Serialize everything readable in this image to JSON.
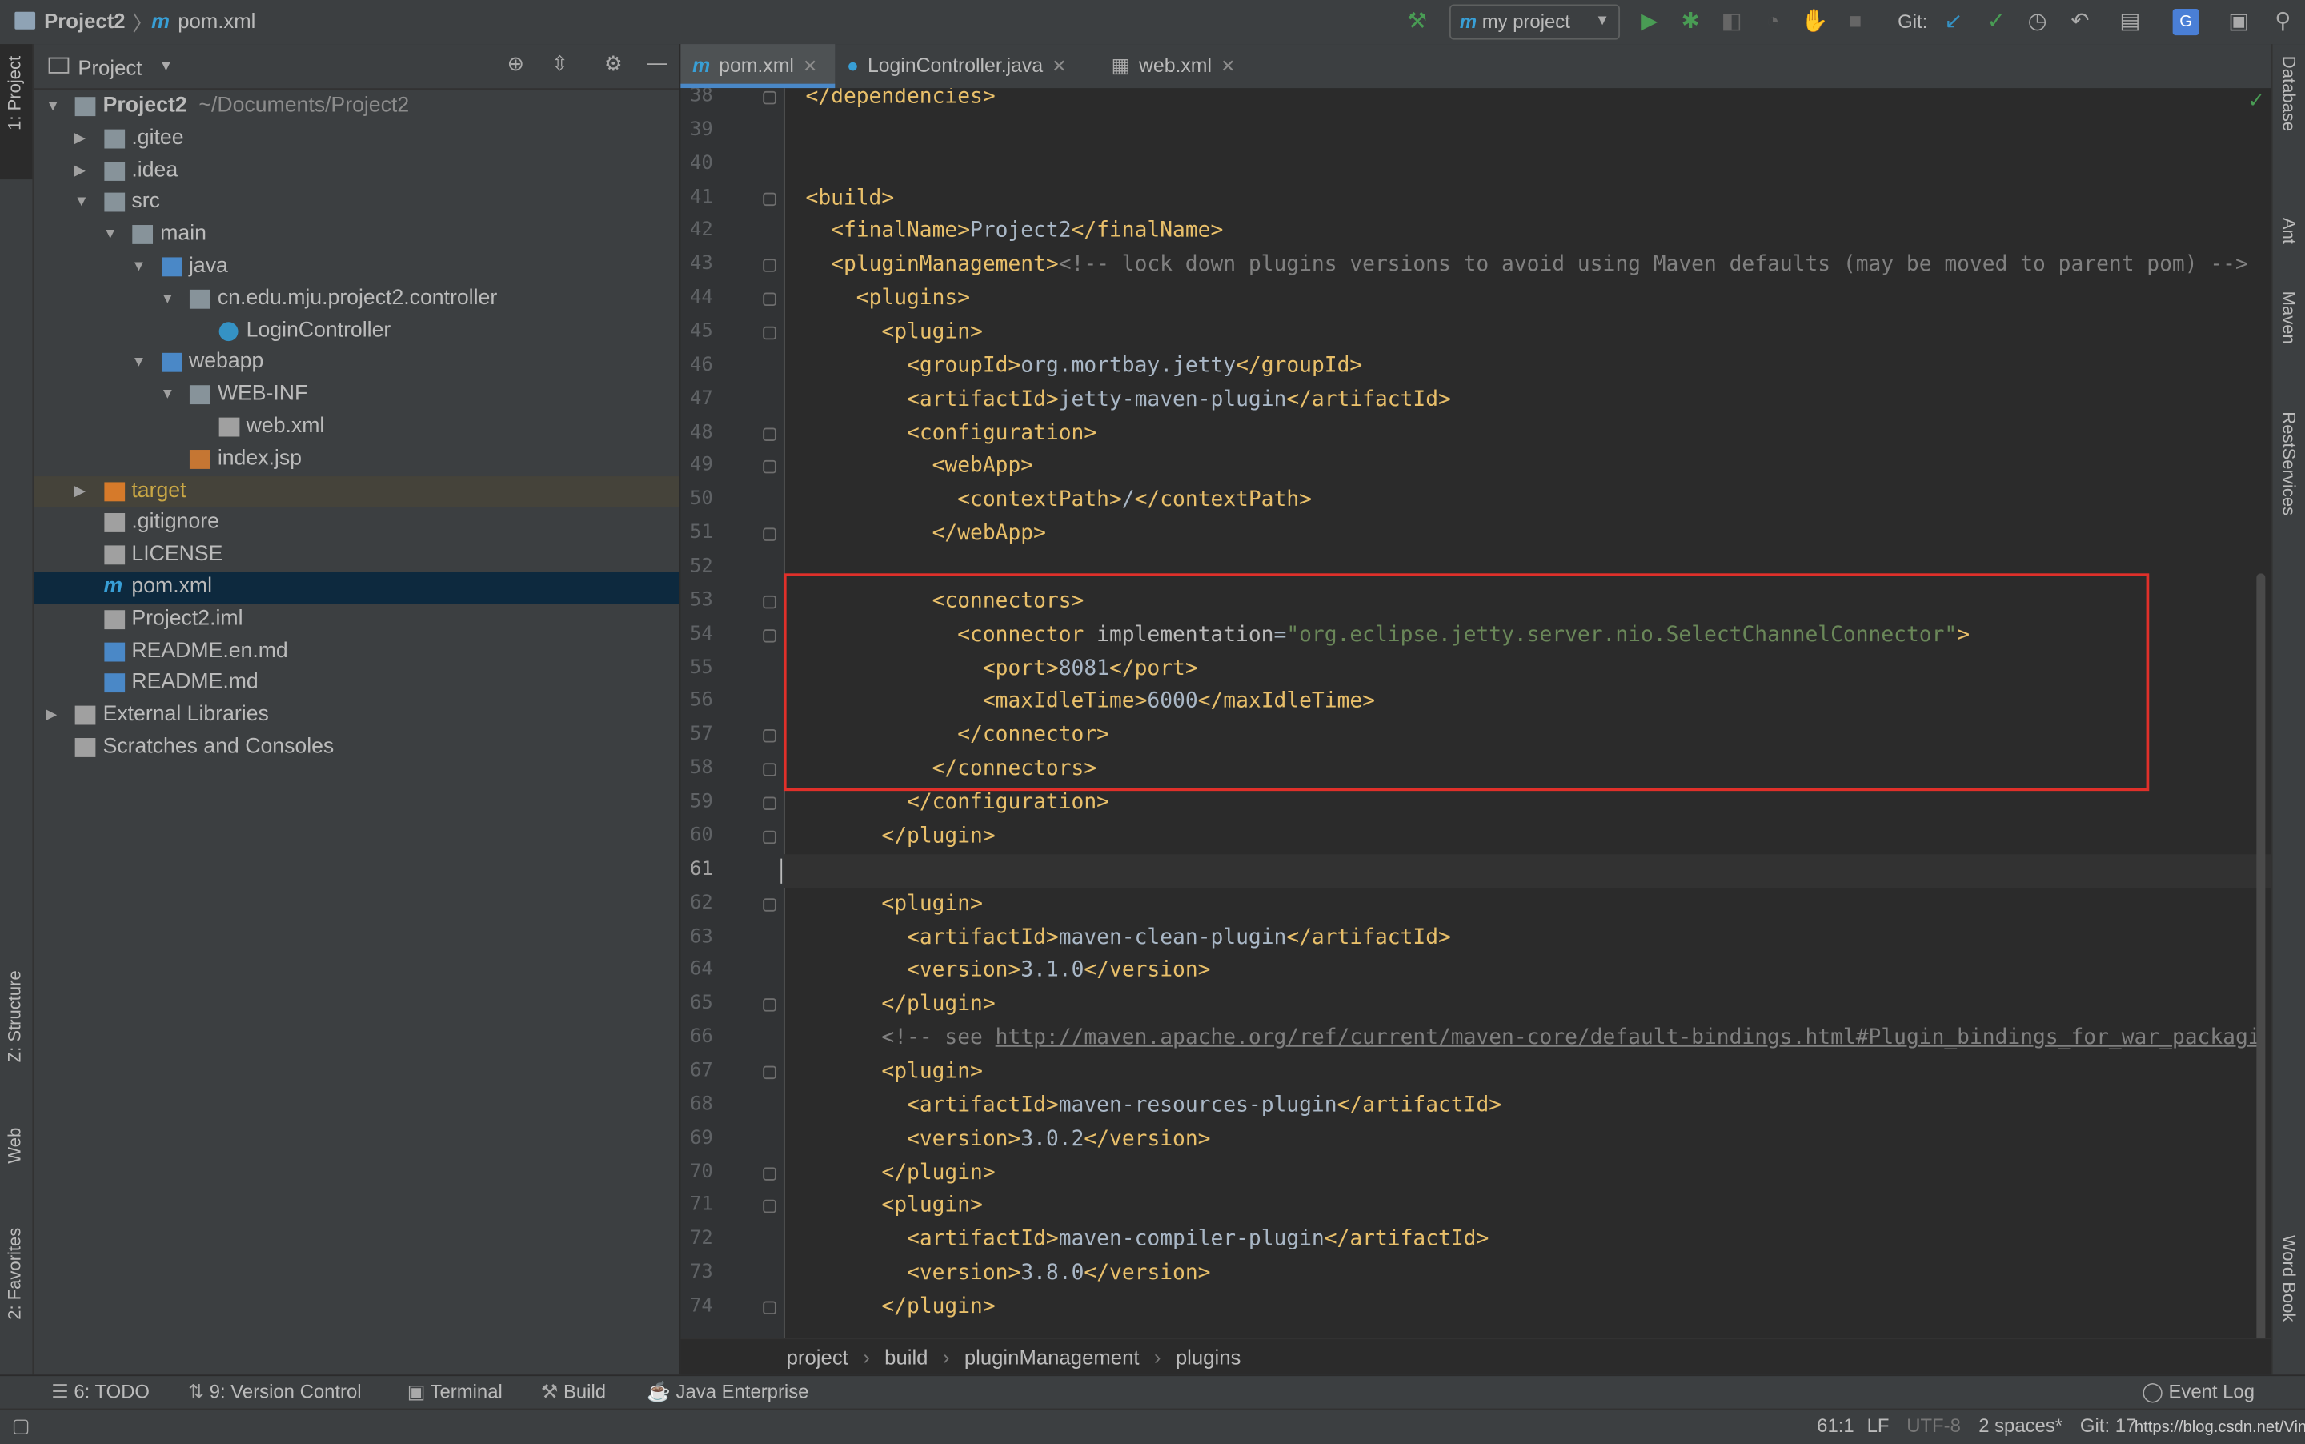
{
  "title_bar": {
    "project": "Project2",
    "file": "pom.xml"
  },
  "toolbar": {
    "run_config": "my project",
    "git_label": "Git:",
    "icons": [
      "build-hammer-icon",
      "run-icon",
      "debug-icon",
      "coverage-icon",
      "profile-icon",
      "attach-icon",
      "stop-icon",
      "git-update-icon",
      "git-commit-icon",
      "history-icon",
      "rollback-icon",
      "project-structure-icon",
      "translate-icon",
      "terminal-icon",
      "search-icon"
    ]
  },
  "left_strip": [
    "1: Project",
    "Z: Structure",
    "Web",
    "2: Favorites"
  ],
  "right_strip": [
    "Database",
    "Ant",
    "Maven",
    "RestServices",
    "Word Book"
  ],
  "project_panel": {
    "title": "Project",
    "tree": [
      {
        "label": "Project2",
        "extra": "~/Documents/Project2",
        "level": 0,
        "arrow": "open",
        "icon": "folder",
        "bold": true
      },
      {
        "label": ".gitee",
        "level": 1,
        "arrow": "closed",
        "icon": "folder"
      },
      {
        "label": ".idea",
        "level": 1,
        "arrow": "closed",
        "icon": "folder"
      },
      {
        "label": "src",
        "level": 1,
        "arrow": "open",
        "icon": "folder"
      },
      {
        "label": "main",
        "level": 2,
        "arrow": "open",
        "icon": "folder"
      },
      {
        "label": "java",
        "level": 3,
        "arrow": "open",
        "icon": "src-folder"
      },
      {
        "label": "cn.edu.mju.project2.controller",
        "level": 4,
        "arrow": "open",
        "icon": "package"
      },
      {
        "label": "LoginController",
        "level": 5,
        "arrow": "none",
        "icon": "class"
      },
      {
        "label": "webapp",
        "level": 3,
        "arrow": "open",
        "icon": "web-folder"
      },
      {
        "label": "WEB-INF",
        "level": 4,
        "arrow": "open",
        "icon": "folder"
      },
      {
        "label": "web.xml",
        "level": 5,
        "arrow": "none",
        "icon": "xml"
      },
      {
        "label": "index.jsp",
        "level": 4,
        "arrow": "none",
        "icon": "jsp"
      },
      {
        "label": "target",
        "level": 1,
        "arrow": "closed",
        "icon": "excluded-folder",
        "state": "excluded"
      },
      {
        "label": ".gitignore",
        "level": 1,
        "arrow": "none",
        "icon": "file"
      },
      {
        "label": "LICENSE",
        "level": 1,
        "arrow": "none",
        "icon": "file"
      },
      {
        "label": "pom.xml",
        "level": 1,
        "arrow": "none",
        "icon": "maven",
        "state": "selected"
      },
      {
        "label": "Project2.iml",
        "level": 1,
        "arrow": "none",
        "icon": "file"
      },
      {
        "label": "README.en.md",
        "level": 1,
        "arrow": "none",
        "icon": "md"
      },
      {
        "label": "README.md",
        "level": 1,
        "arrow": "none",
        "icon": "md"
      },
      {
        "label": "External Libraries",
        "level": 0,
        "arrow": "closed",
        "icon": "library"
      },
      {
        "label": "Scratches and Consoles",
        "level": 0,
        "arrow": "none",
        "icon": "scratch"
      }
    ]
  },
  "tabs": [
    {
      "label": "pom.xml",
      "icon": "maven",
      "active": true
    },
    {
      "label": "LoginController.java",
      "icon": "class"
    },
    {
      "label": "web.xml",
      "icon": "xml"
    }
  ],
  "editor": {
    "current_line": 61,
    "first_line": 38,
    "lines": [
      "</dependencies>",
      "",
      "",
      "<build>",
      "  <finalName>Project2</finalName>",
      "  <pluginManagement><!-- lock down plugins versions to avoid using Maven defaults (may be moved to parent pom) -->",
      "    <plugins>",
      "      <plugin>",
      "        <groupId>org.mortbay.jetty</groupId>",
      "        <artifactId>jetty-maven-plugin</artifactId>",
      "        <configuration>",
      "          <webApp>",
      "            <contextPath>/</contextPath>",
      "          </webApp>",
      "",
      "          <connectors>",
      "            <connector implementation=\"org.eclipse.jetty.server.nio.SelectChannelConnector\">",
      "              <port>8081</port>",
      "              <maxIdleTime>6000</maxIdleTime>",
      "            </connector>",
      "          </connectors>",
      "        </configuration>",
      "      </plugin>",
      "",
      "      <plugin>",
      "        <artifactId>maven-clean-plugin</artifactId>",
      "        <version>3.1.0</version>",
      "      </plugin>",
      "      <!-- see http://maven.apache.org/ref/current/maven-core/default-bindings.html#Plugin_bindings_for_war_packagi",
      "      <plugin>",
      "        <artifactId>maven-resources-plugin</artifactId>",
      "        <version>3.0.2</version>",
      "      </plugin>",
      "      <plugin>",
      "        <artifactId>maven-compiler-plugin</artifactId>",
      "        <version>3.8.0</version>",
      "      </plugin>"
    ],
    "highlight_color": "#e0302a"
  },
  "breadcrumb": [
    "project",
    "build",
    "pluginManagement",
    "plugins"
  ],
  "bottom_tools": [
    {
      "label": "6: TODO",
      "icon": "list-icon"
    },
    {
      "label": "9: Version Control",
      "icon": "vcs-icon"
    },
    {
      "label": "Terminal",
      "icon": "terminal-icon"
    },
    {
      "label": "Build",
      "icon": "hammer-icon"
    },
    {
      "label": "Java Enterprise",
      "icon": "javaee-icon"
    }
  ],
  "event_log": "Event Log",
  "status": {
    "position": "61:1",
    "line_sep": "LF",
    "encoding": "UTF-8",
    "indent": "2 spaces*",
    "git": "Git: 17",
    "watermark": "https://blog.csdn.net/Vinseqy"
  }
}
